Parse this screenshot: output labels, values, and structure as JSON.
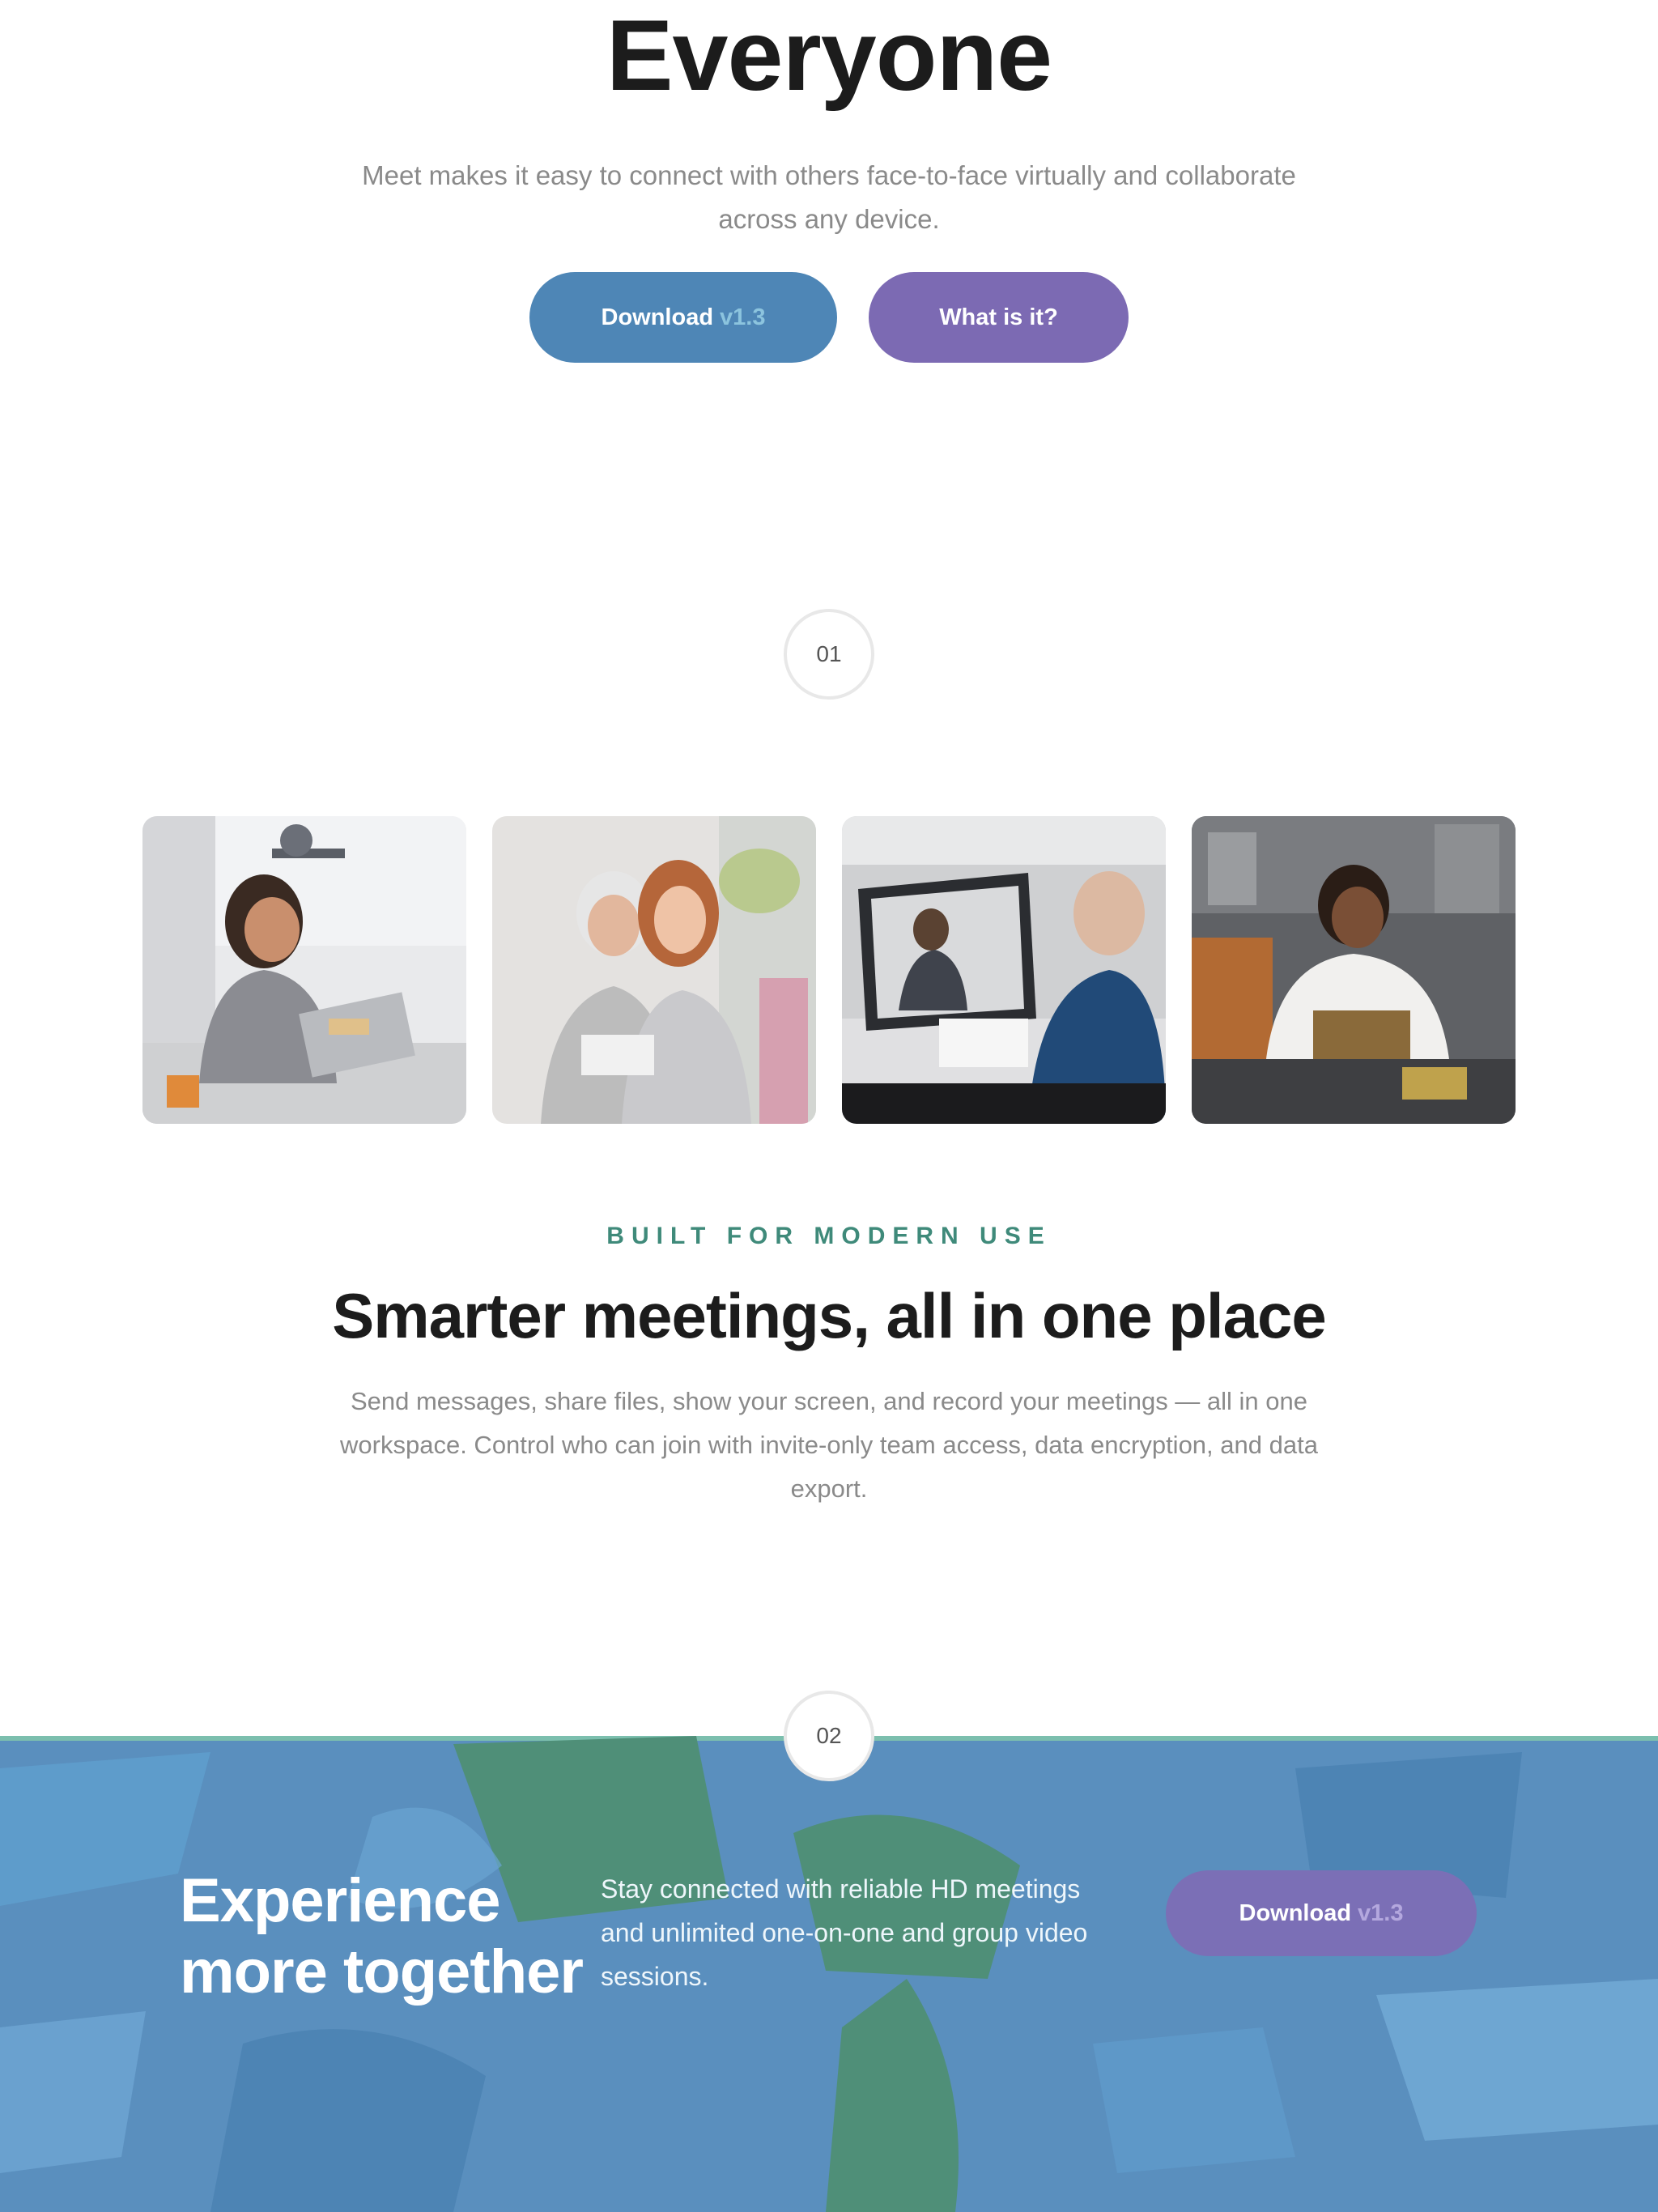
{
  "hero": {
    "title": "Everyone",
    "subtitle": "Meet makes it easy to connect with others face-to-face virtually and collaborate across any device.",
    "download_label": "Download",
    "download_version": "v1.3",
    "what_label": "What is it?"
  },
  "steps": {
    "first": "01",
    "second": "02"
  },
  "photos": [
    {
      "icon": "woman-laptop-photo"
    },
    {
      "icon": "grandmother-granddaughter-photo"
    },
    {
      "icon": "video-call-photo"
    },
    {
      "icon": "man-phone-photo"
    }
  ],
  "features": {
    "eyebrow": "BUILT FOR MODERN USE",
    "title": "Smarter meetings, all in one place",
    "body": "Send messages, share files, show your screen, and record your meetings — all in one workspace. Control who can join with invite-only team access, data encryption, and data export."
  },
  "banner": {
    "title": "Experience more together",
    "text": "Stay connected with reliable HD meetings and unlimited one-on-one and group video sessions.",
    "download_label": "Download",
    "download_version": "v1.3"
  },
  "colors": {
    "primary_blue": "#4e86b6",
    "purple": "#7c6ab3",
    "teal_accent": "#3f8a7a",
    "banner_blue": "#5a8fbe",
    "banner_green": "#4f8f78"
  }
}
